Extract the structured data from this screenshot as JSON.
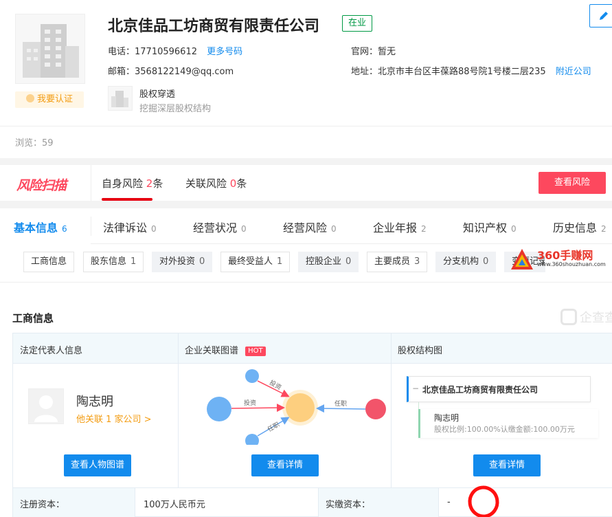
{
  "company": {
    "name": "北京佳品工坊商贸有限责任公司",
    "status": "在业",
    "phone_label": "电话：",
    "phone": "17710596612",
    "more_phones": "更多号码",
    "website_label": "官网：",
    "website": "暂无",
    "email_label": "邮箱：",
    "email": "3568122149@qq.com",
    "address_label": "地址：",
    "address": "北京市丰台区丰葆路88号院1号楼二层235",
    "nearby": "附近公司",
    "certify": "我要认证",
    "equity_title": "股权穿透",
    "equity_sub": "挖掘深层股权结构",
    "views": "浏览：59"
  },
  "risk": {
    "logo": "风险扫描",
    "self_label": "自身风险",
    "self_count": "2",
    "self_unit": "条",
    "related_label": "关联风险",
    "related_count": "0",
    "related_unit": "条",
    "button": "查看风险"
  },
  "tabs": [
    {
      "label": "基本信息",
      "count": "6"
    },
    {
      "label": "法律诉讼",
      "count": "0"
    },
    {
      "label": "经营状况",
      "count": "0"
    },
    {
      "label": "经营风险",
      "count": "0"
    },
    {
      "label": "企业年报",
      "count": "2"
    },
    {
      "label": "知识产权",
      "count": "0"
    },
    {
      "label": "历史信息",
      "count": "2"
    }
  ],
  "subtabs": [
    {
      "label": "工商信息",
      "count": ""
    },
    {
      "label": "股东信息",
      "count": "1"
    },
    {
      "label": "对外投资",
      "count": "0"
    },
    {
      "label": "最终受益人",
      "count": "1"
    },
    {
      "label": "控股企业",
      "count": "0"
    },
    {
      "label": "主要成员",
      "count": "3"
    },
    {
      "label": "分支机构",
      "count": "0"
    },
    {
      "label": "变更记录",
      "count": ""
    }
  ],
  "watermark": {
    "title": "360手赚网",
    "url": "www.360shouzhuan.com"
  },
  "section": {
    "title": "工商信息",
    "brand": "企查查",
    "col1_header": "法定代表人信息",
    "col2_header": "企业关联图谱",
    "hot": "HOT",
    "col3_header": "股权结构图",
    "person_name": "陶志明",
    "person_link": "他关联 1 家公司 >",
    "btn_person_graph": "查看人物图谱",
    "btn_detail_1": "查看详情",
    "btn_detail_2": "查看详情",
    "graph_invest_1": "投资",
    "graph_invest_2": "投资",
    "graph_post_1": "任职",
    "graph_post_2": "任职",
    "equity_company": "北京佳品工坊商贸有限责任公司",
    "equity_person": "陶志明",
    "equity_detail": "股权比例:100.00%认缴金额:100.00万元",
    "reg_capital_label": "注册资本：",
    "reg_capital": "100万人民币元",
    "paid_capital_label": "实缴资本：",
    "paid_capital": "-"
  },
  "colors": {
    "accent": "#128bed",
    "risk": "#fd485e",
    "status_green": "#009944",
    "hot": "#fd485e"
  }
}
